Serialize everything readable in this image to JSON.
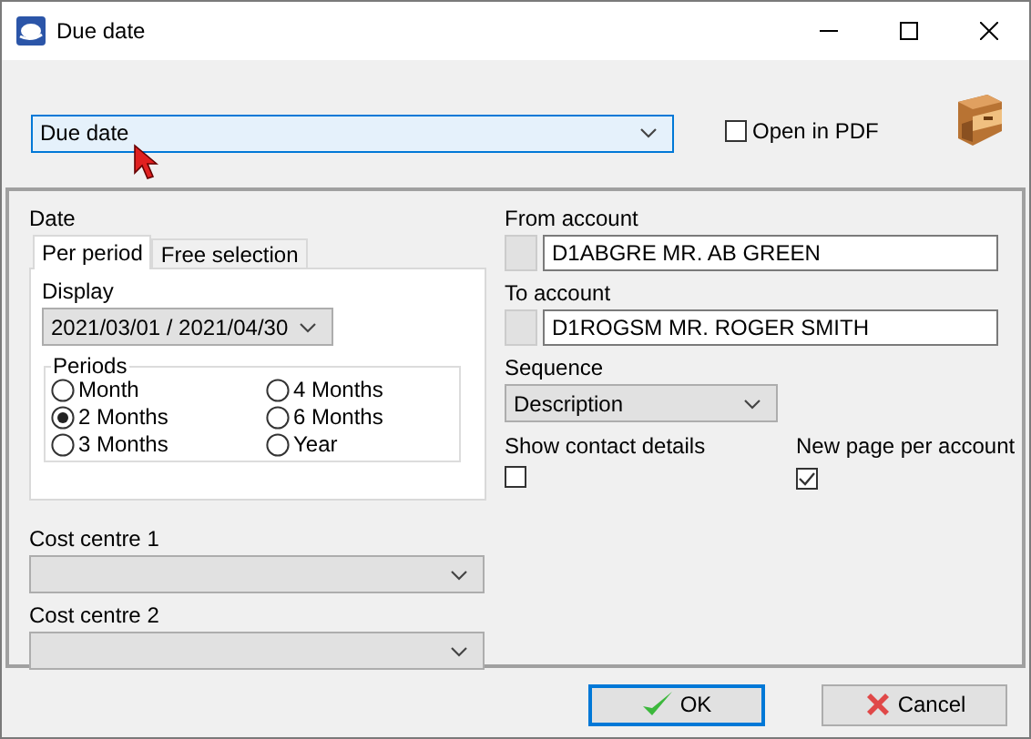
{
  "window": {
    "title": "Due date"
  },
  "report": {
    "value": "Due date",
    "focused": true
  },
  "open_in_pdf": {
    "label": "Open in PDF",
    "checked": false
  },
  "date": {
    "label": "Date",
    "tabs": [
      {
        "label": "Per period",
        "selected": true
      },
      {
        "label": "Free selection",
        "selected": false
      }
    ],
    "display": {
      "label": "Display",
      "value": "2021/03/01 / 2021/04/30"
    },
    "periods": {
      "label": "Periods",
      "options": [
        {
          "label": "Month",
          "selected": false
        },
        {
          "label": "4 Months",
          "selected": false
        },
        {
          "label": "2 Months",
          "selected": true
        },
        {
          "label": "6 Months",
          "selected": false
        },
        {
          "label": "3 Months",
          "selected": false
        },
        {
          "label": "Year",
          "selected": false
        }
      ]
    }
  },
  "cost_centre_1": {
    "label": "Cost centre 1"
  },
  "cost_centre_2": {
    "label": "Cost centre 2"
  },
  "from_account": {
    "label": "From account",
    "value": "D1ABGRE MR. AB GREEN"
  },
  "to_account": {
    "label": "To account",
    "value": "D1ROGSM MR. ROGER SMITH"
  },
  "sequence": {
    "label": "Sequence",
    "value": "Description"
  },
  "show_contact_details": {
    "label": "Show contact details",
    "checked": false
  },
  "new_page_per_account": {
    "label": "New page per account",
    "checked": true
  },
  "buttons": [
    {
      "label": "OK",
      "kind": "ok",
      "default": true
    },
    {
      "label": "Cancel",
      "kind": "cancel",
      "default": false
    }
  ]
}
